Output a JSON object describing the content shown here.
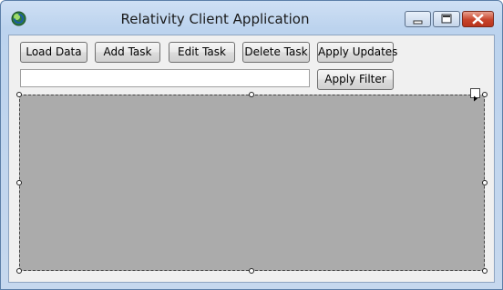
{
  "window": {
    "title": "Relativity Client Application",
    "controls": {
      "minimize": "minimize-icon",
      "maximize": "maximize-icon",
      "close": "close-icon"
    }
  },
  "toolbar": {
    "load_data": "Load Data",
    "add_task": "Add Task",
    "edit_task": "Edit Task",
    "delete_task": "Delete Task",
    "apply_updates": "Apply Updates"
  },
  "filter": {
    "value": "",
    "apply_label": "Apply Filter"
  },
  "colors": {
    "grid_background": "#ababab",
    "close_button": "#c8432a",
    "titlebar": "#bcd3ee"
  }
}
